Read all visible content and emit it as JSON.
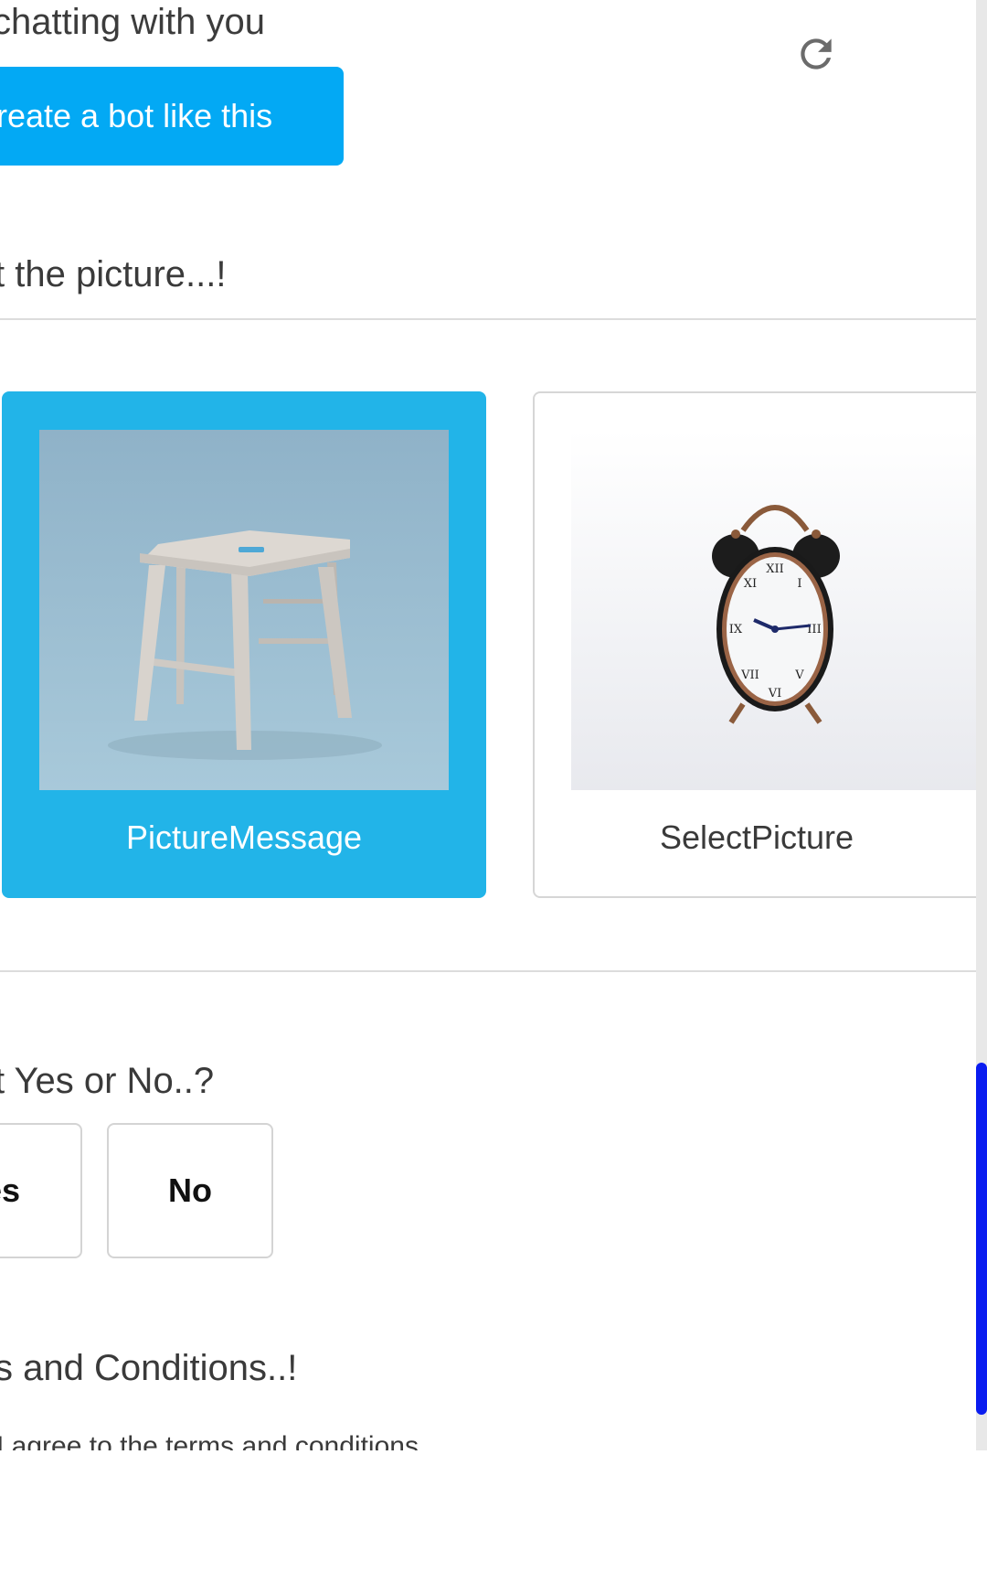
{
  "header": {
    "chat_text": "chatting with you",
    "create_button_label": "reate a bot like this",
    "refresh_icon": "refresh-icon"
  },
  "picture_question": {
    "text": "t the picture...!",
    "options": [
      {
        "label": "PictureMessage",
        "image": "wooden-stool-photo",
        "selected": true
      },
      {
        "label": "SelectPicture",
        "image": "alarm-clock-photo",
        "selected": false
      }
    ]
  },
  "yes_no_question": {
    "text": "t Yes or No..?",
    "yes_label": "es",
    "no_label": "No"
  },
  "terms": {
    "heading": "s and Conditions..!",
    "checkbox_text": "I agree to the terms and conditions"
  },
  "colors": {
    "accent": "#03a9f4",
    "selected_card": "#22b4e8",
    "scroll_thumb": "#0a1cf0"
  }
}
